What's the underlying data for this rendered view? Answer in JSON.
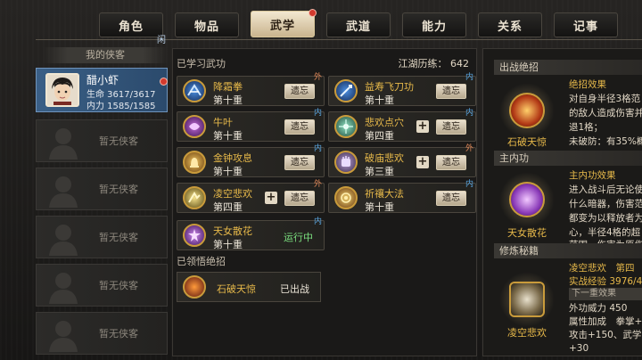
{
  "tabs": [
    {
      "label": "角色",
      "active": false
    },
    {
      "label": "物品",
      "active": false
    },
    {
      "label": "武学",
      "active": true
    },
    {
      "label": "武道",
      "active": false
    },
    {
      "label": "能力",
      "active": false
    },
    {
      "label": "关系",
      "active": false
    },
    {
      "label": "记事",
      "active": false
    }
  ],
  "left": {
    "header": "我的侠客",
    "hero": {
      "name": "醋小虾",
      "hp": "生命 3617/3617",
      "mp": "内力 1585/1585",
      "state": "闲"
    },
    "empty_label": "暂无侠客"
  },
  "middle": {
    "learned_title": "已学习武功",
    "exp": "江湖历练： 642",
    "forget_label": "遗忘",
    "skills": [
      {
        "name": "降霜拳",
        "level": "第十重",
        "tag": "外",
        "plus": false
      },
      {
        "name": "益寿飞刀功",
        "level": "第十重",
        "tag": "内",
        "plus": false
      },
      {
        "name": "牛叶",
        "level": "第十重",
        "tag": "内",
        "plus": false
      },
      {
        "name": "悲欢点穴",
        "level": "第四重",
        "tag": "内",
        "plus": true
      },
      {
        "name": "金钟攻息",
        "level": "第十重",
        "tag": "内",
        "plus": false
      },
      {
        "name": "破庙悲欢",
        "level": "第三重",
        "tag": "外",
        "plus": true
      },
      {
        "name": "凌空悲欢",
        "level": "第四重",
        "tag": "外",
        "plus": true
      },
      {
        "name": "祈禳大法",
        "level": "第十重",
        "tag": "内",
        "plus": false
      },
      {
        "name": "天女散花",
        "level": "第十重",
        "tag": "内",
        "status": "运行中"
      }
    ],
    "ult_title": "已领悟绝招",
    "ult": {
      "name": "石破天惊",
      "status": "已出战"
    }
  },
  "right": {
    "battle_title": "出战绝招",
    "battle_icon_label": "石破天惊",
    "battle_lines": [
      "绝招效果",
      "对自身半径3格范",
      "的敌人造成伤害并",
      "退1格；",
      "未破防：有35%概"
    ],
    "inner_title": "主内功",
    "inner_icon_label": "天女散花",
    "inner_lines": [
      "主内功效果",
      "进入战斗后无论使",
      "什么暗器，伤害范",
      "都变为以释放者为",
      "心，半径4格的超",
      "范围，伤害为原伤"
    ],
    "cultivate_title": "修炼秘籍",
    "cultivate_icon_label": "凌空悲欢",
    "cultivate_lines": [
      "凌空悲欢　第四",
      "实战经验 3976/40",
      "下一重效果",
      "外功威力 450",
      "属性加成　拳掌+",
      "攻击+150、武学常",
      "+30"
    ]
  },
  "colors": {
    "accent_gold": "#e7b94a",
    "hero_blue": "#3a5f86",
    "running_green": "#7be07f"
  }
}
